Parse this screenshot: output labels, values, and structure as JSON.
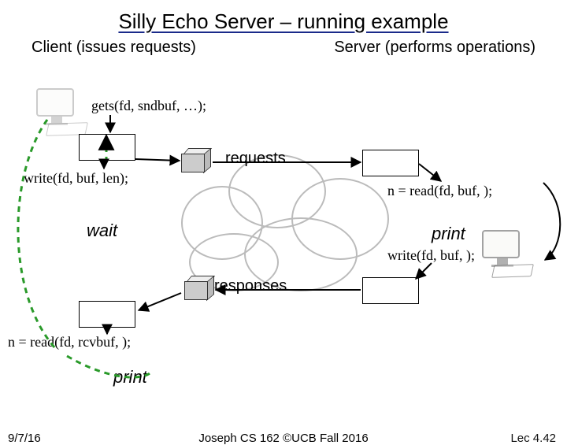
{
  "title": "Silly Echo Server – running example",
  "roles": {
    "client": "Client (issues requests)",
    "server": "Server (performs operations)"
  },
  "code": {
    "gets": "gets(fd, sndbuf, …);",
    "write": "write(fd, buf, len);",
    "wait": "wait",
    "readClient": "n = read(fd, rcvbuf, );",
    "printClient": "print",
    "readServer": "n = read(fd, buf, );",
    "printServer": "print",
    "writeServer": "write(fd, buf, );"
  },
  "labels": {
    "requests": "requests",
    "responses": "responses"
  },
  "footer": {
    "date": "9/7/16",
    "center": "Joseph CS 162 ©UCB Fall 2016",
    "right": "Lec 4.42"
  }
}
